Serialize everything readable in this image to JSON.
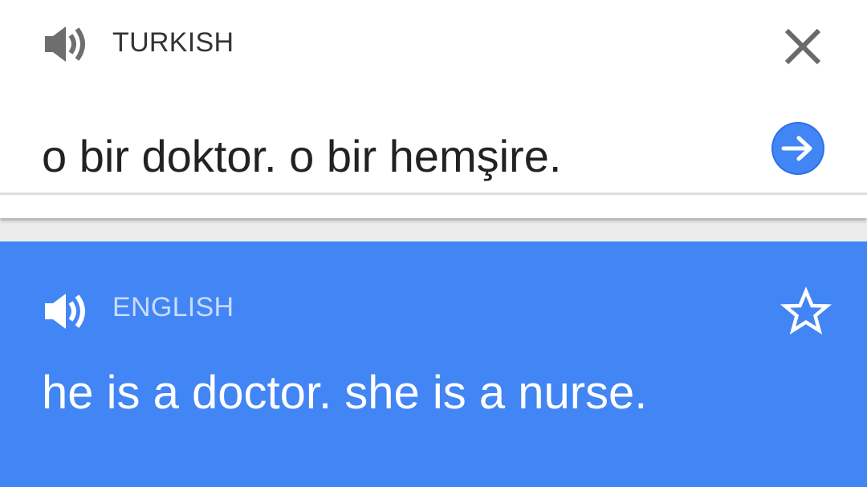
{
  "source": {
    "language": "TURKISH",
    "text": "o bir doktor. o bir hemşire.",
    "speaker_icon": "speaker-icon",
    "close_icon": "close-icon",
    "translate_icon": "arrow-right-circle-icon"
  },
  "result": {
    "language": "ENGLISH",
    "text": "he is a doctor. she is a nurse.",
    "speaker_icon": "speaker-icon",
    "star_icon": "star-outline-icon"
  },
  "colors": {
    "result_background": "#4285f4",
    "source_background": "#ffffff",
    "accent_button": "#4285f4",
    "page_gap": "#ececec"
  }
}
